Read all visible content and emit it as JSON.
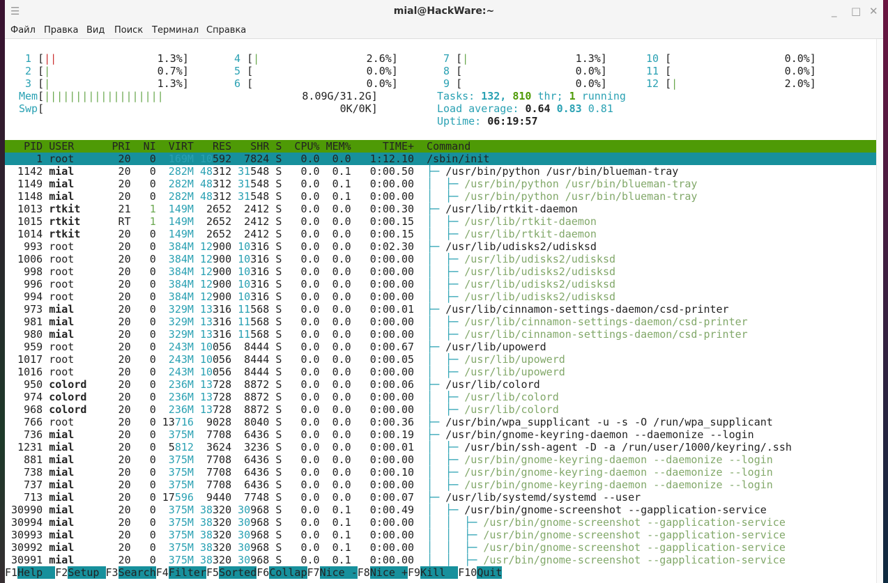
{
  "window": {
    "title": "mial@HackWare:~",
    "menu_icon": "hamburger-icon",
    "minimize_icon": "minimize-icon",
    "maximize_icon": "maximize-icon",
    "close_icon": "close-icon"
  },
  "menu": [
    "Файл",
    "Правка",
    "Вид",
    "Поиск",
    "Терминал",
    "Справка"
  ],
  "meters": {
    "cpus": [
      {
        "n": "1",
        "bar": "||",
        "pct": "1.3%]"
      },
      {
        "n": "2",
        "bar": "|",
        "pct": "0.7%]"
      },
      {
        "n": "3",
        "bar": "|",
        "pct": "1.3%]"
      },
      {
        "n": "4",
        "bar": "|",
        "pct": "2.6%]"
      },
      {
        "n": "5",
        "bar": "",
        "pct": "0.0%]"
      },
      {
        "n": "6",
        "bar": "",
        "pct": "0.0%]"
      },
      {
        "n": "7",
        "bar": "|",
        "pct": "1.3%]"
      },
      {
        "n": "8",
        "bar": "",
        "pct": "0.0%]"
      },
      {
        "n": "9",
        "bar": "",
        "pct": "0.0%]"
      },
      {
        "n": "10",
        "bar": "",
        "pct": "0.0%]"
      },
      {
        "n": "11",
        "bar": "",
        "pct": "0.0%]"
      },
      {
        "n": "12",
        "bar": "|",
        "pct": "2.0%]"
      }
    ],
    "mem": {
      "label": "Mem",
      "bar": "|||||||||||||||||||",
      "value": "8.09G/31.2G]"
    },
    "swp": {
      "label": "Swp",
      "value": "0K/0K]"
    },
    "tasks": {
      "label": "Tasks:",
      "count": "132,",
      "thr": "810",
      "thr_label": "thr;",
      "running": "1",
      "running_label": "running"
    },
    "load": {
      "label": "Load average:",
      "v1": "0.64",
      "v2": "0.83",
      "v3": "0.81"
    },
    "uptime": {
      "label": "Uptime:",
      "value": "06:19:57"
    }
  },
  "columns": [
    "PID",
    "USER",
    "PRI",
    "NI",
    "VIRT",
    "RES",
    "SHR",
    "S",
    "CPU%",
    "MEM%",
    "TIME+",
    "Command"
  ],
  "processes": [
    {
      "pid": "1",
      "user": "root",
      "pri": "20",
      "ni": "0",
      "virt": "169M",
      "res": "10592",
      "shr": "7824",
      "s": "S",
      "cpu": "0.0",
      "mem": "0.0",
      "time": "1:12.10",
      "cmd": "/sbin/init",
      "depth": 0,
      "selected": true
    },
    {
      "pid": "1142",
      "user": "mial",
      "pri": "20",
      "ni": "0",
      "virt": "282M",
      "res": "48312",
      "shr": "31548",
      "s": "S",
      "cpu": "0.0",
      "mem": "0.1",
      "time": "0:00.50",
      "cmd": "/usr/bin/python /usr/bin/blueman-tray",
      "depth": 1
    },
    {
      "pid": "1149",
      "user": "mial",
      "pri": "20",
      "ni": "0",
      "virt": "282M",
      "res": "48312",
      "shr": "31548",
      "s": "S",
      "cpu": "0.0",
      "mem": "0.1",
      "time": "0:00.00",
      "cmd": "/usr/bin/python /usr/bin/blueman-tray",
      "depth": 2
    },
    {
      "pid": "1148",
      "user": "mial",
      "pri": "20",
      "ni": "0",
      "virt": "282M",
      "res": "48312",
      "shr": "31548",
      "s": "S",
      "cpu": "0.0",
      "mem": "0.1",
      "time": "0:00.00",
      "cmd": "/usr/bin/python /usr/bin/blueman-tray",
      "depth": 2
    },
    {
      "pid": "1013",
      "user": "rtkit",
      "pri": "21",
      "ni": "1",
      "virt": "149M",
      "res": "2652",
      "shr": "2412",
      "s": "S",
      "cpu": "0.0",
      "mem": "0.0",
      "time": "0:00.30",
      "cmd": "/usr/lib/rtkit-daemon",
      "depth": 1
    },
    {
      "pid": "1015",
      "user": "rtkit",
      "pri": "RT",
      "ni": "1",
      "virt": "149M",
      "res": "2652",
      "shr": "2412",
      "s": "S",
      "cpu": "0.0",
      "mem": "0.0",
      "time": "0:00.15",
      "cmd": "/usr/lib/rtkit-daemon",
      "depth": 2
    },
    {
      "pid": "1014",
      "user": "rtkit",
      "pri": "20",
      "ni": "0",
      "virt": "149M",
      "res": "2652",
      "shr": "2412",
      "s": "S",
      "cpu": "0.0",
      "mem": "0.0",
      "time": "0:00.15",
      "cmd": "/usr/lib/rtkit-daemon",
      "depth": 2
    },
    {
      "pid": "993",
      "user": "root",
      "pri": "20",
      "ni": "0",
      "virt": "384M",
      "res": "12900",
      "shr": "10316",
      "s": "S",
      "cpu": "0.0",
      "mem": "0.0",
      "time": "0:02.30",
      "cmd": "/usr/lib/udisks2/udisksd",
      "depth": 1
    },
    {
      "pid": "1006",
      "user": "root",
      "pri": "20",
      "ni": "0",
      "virt": "384M",
      "res": "12900",
      "shr": "10316",
      "s": "S",
      "cpu": "0.0",
      "mem": "0.0",
      "time": "0:00.00",
      "cmd": "/usr/lib/udisks2/udisksd",
      "depth": 2
    },
    {
      "pid": "998",
      "user": "root",
      "pri": "20",
      "ni": "0",
      "virt": "384M",
      "res": "12900",
      "shr": "10316",
      "s": "S",
      "cpu": "0.0",
      "mem": "0.0",
      "time": "0:00.00",
      "cmd": "/usr/lib/udisks2/udisksd",
      "depth": 2
    },
    {
      "pid": "996",
      "user": "root",
      "pri": "20",
      "ni": "0",
      "virt": "384M",
      "res": "12900",
      "shr": "10316",
      "s": "S",
      "cpu": "0.0",
      "mem": "0.0",
      "time": "0:00.00",
      "cmd": "/usr/lib/udisks2/udisksd",
      "depth": 2
    },
    {
      "pid": "994",
      "user": "root",
      "pri": "20",
      "ni": "0",
      "virt": "384M",
      "res": "12900",
      "shr": "10316",
      "s": "S",
      "cpu": "0.0",
      "mem": "0.0",
      "time": "0:00.00",
      "cmd": "/usr/lib/udisks2/udisksd",
      "depth": 2
    },
    {
      "pid": "973",
      "user": "mial",
      "pri": "20",
      "ni": "0",
      "virt": "329M",
      "res": "13316",
      "shr": "11568",
      "s": "S",
      "cpu": "0.0",
      "mem": "0.0",
      "time": "0:00.01",
      "cmd": "/usr/lib/cinnamon-settings-daemon/csd-printer",
      "depth": 1
    },
    {
      "pid": "981",
      "user": "mial",
      "pri": "20",
      "ni": "0",
      "virt": "329M",
      "res": "13316",
      "shr": "11568",
      "s": "S",
      "cpu": "0.0",
      "mem": "0.0",
      "time": "0:00.00",
      "cmd": "/usr/lib/cinnamon-settings-daemon/csd-printer",
      "depth": 2
    },
    {
      "pid": "980",
      "user": "mial",
      "pri": "20",
      "ni": "0",
      "virt": "329M",
      "res": "13316",
      "shr": "11568",
      "s": "S",
      "cpu": "0.0",
      "mem": "0.0",
      "time": "0:00.00",
      "cmd": "/usr/lib/cinnamon-settings-daemon/csd-printer",
      "depth": 2
    },
    {
      "pid": "959",
      "user": "root",
      "pri": "20",
      "ni": "0",
      "virt": "243M",
      "res": "10056",
      "shr": "8444",
      "s": "S",
      "cpu": "0.0",
      "mem": "0.0",
      "time": "0:00.67",
      "cmd": "/usr/lib/upowerd",
      "depth": 1
    },
    {
      "pid": "1017",
      "user": "root",
      "pri": "20",
      "ni": "0",
      "virt": "243M",
      "res": "10056",
      "shr": "8444",
      "s": "S",
      "cpu": "0.0",
      "mem": "0.0",
      "time": "0:00.05",
      "cmd": "/usr/lib/upowerd",
      "depth": 2
    },
    {
      "pid": "1016",
      "user": "root",
      "pri": "20",
      "ni": "0",
      "virt": "243M",
      "res": "10056",
      "shr": "8444",
      "s": "S",
      "cpu": "0.0",
      "mem": "0.0",
      "time": "0:00.00",
      "cmd": "/usr/lib/upowerd",
      "depth": 2
    },
    {
      "pid": "950",
      "user": "colord",
      "pri": "20",
      "ni": "0",
      "virt": "236M",
      "res": "13728",
      "shr": "8872",
      "s": "S",
      "cpu": "0.0",
      "mem": "0.0",
      "time": "0:00.06",
      "cmd": "/usr/lib/colord",
      "depth": 1
    },
    {
      "pid": "974",
      "user": "colord",
      "pri": "20",
      "ni": "0",
      "virt": "236M",
      "res": "13728",
      "shr": "8872",
      "s": "S",
      "cpu": "0.0",
      "mem": "0.0",
      "time": "0:00.00",
      "cmd": "/usr/lib/colord",
      "depth": 2
    },
    {
      "pid": "968",
      "user": "colord",
      "pri": "20",
      "ni": "0",
      "virt": "236M",
      "res": "13728",
      "shr": "8872",
      "s": "S",
      "cpu": "0.0",
      "mem": "0.0",
      "time": "0:00.00",
      "cmd": "/usr/lib/colord",
      "depth": 2
    },
    {
      "pid": "766",
      "user": "root",
      "pri": "20",
      "ni": "0",
      "virt": "13716",
      "res": "9028",
      "shr": "8040",
      "s": "S",
      "cpu": "0.0",
      "mem": "0.0",
      "time": "0:00.36",
      "cmd": "/usr/bin/wpa_supplicant -u -s -O /run/wpa_supplicant",
      "depth": 1
    },
    {
      "pid": "736",
      "user": "mial",
      "pri": "20",
      "ni": "0",
      "virt": "375M",
      "res": "7708",
      "shr": "6436",
      "s": "S",
      "cpu": "0.0",
      "mem": "0.0",
      "time": "0:00.19",
      "cmd": "/usr/bin/gnome-keyring-daemon --daemonize --login",
      "depth": 1
    },
    {
      "pid": "1231",
      "user": "mial",
      "pri": "20",
      "ni": "0",
      "virt": "5812",
      "res": "3624",
      "shr": "3236",
      "s": "S",
      "cpu": "0.0",
      "mem": "0.0",
      "time": "0:00.01",
      "cmd": "/usr/bin/ssh-agent -D -a /run/user/1000/keyring/.ssh",
      "depth": 2,
      "normal": true
    },
    {
      "pid": "881",
      "user": "mial",
      "pri": "20",
      "ni": "0",
      "virt": "375M",
      "res": "7708",
      "shr": "6436",
      "s": "S",
      "cpu": "0.0",
      "mem": "0.0",
      "time": "0:00.00",
      "cmd": "/usr/bin/gnome-keyring-daemon --daemonize --login",
      "depth": 2
    },
    {
      "pid": "738",
      "user": "mial",
      "pri": "20",
      "ni": "0",
      "virt": "375M",
      "res": "7708",
      "shr": "6436",
      "s": "S",
      "cpu": "0.0",
      "mem": "0.0",
      "time": "0:00.10",
      "cmd": "/usr/bin/gnome-keyring-daemon --daemonize --login",
      "depth": 2
    },
    {
      "pid": "737",
      "user": "mial",
      "pri": "20",
      "ni": "0",
      "virt": "375M",
      "res": "7708",
      "shr": "6436",
      "s": "S",
      "cpu": "0.0",
      "mem": "0.0",
      "time": "0:00.00",
      "cmd": "/usr/bin/gnome-keyring-daemon --daemonize --login",
      "depth": 2
    },
    {
      "pid": "713",
      "user": "mial",
      "pri": "20",
      "ni": "0",
      "virt": "17596",
      "res": "9440",
      "shr": "7748",
      "s": "S",
      "cpu": "0.0",
      "mem": "0.0",
      "time": "0:00.07",
      "cmd": "/usr/lib/systemd/systemd --user",
      "depth": 1
    },
    {
      "pid": "30990",
      "user": "mial",
      "pri": "20",
      "ni": "0",
      "virt": "375M",
      "res": "38320",
      "shr": "30968",
      "s": "S",
      "cpu": "0.0",
      "mem": "0.1",
      "time": "0:00.49",
      "cmd": "/usr/bin/gnome-screenshot --gapplication-service",
      "depth": 2,
      "normal": true
    },
    {
      "pid": "30994",
      "user": "mial",
      "pri": "20",
      "ni": "0",
      "virt": "375M",
      "res": "38320",
      "shr": "30968",
      "s": "S",
      "cpu": "0.0",
      "mem": "0.1",
      "time": "0:00.00",
      "cmd": "/usr/bin/gnome-screenshot --gapplication-service",
      "depth": 3
    },
    {
      "pid": "30993",
      "user": "mial",
      "pri": "20",
      "ni": "0",
      "virt": "375M",
      "res": "38320",
      "shr": "30968",
      "s": "S",
      "cpu": "0.0",
      "mem": "0.1",
      "time": "0:00.00",
      "cmd": "/usr/bin/gnome-screenshot --gapplication-service",
      "depth": 3
    },
    {
      "pid": "30992",
      "user": "mial",
      "pri": "20",
      "ni": "0",
      "virt": "375M",
      "res": "38320",
      "shr": "30968",
      "s": "S",
      "cpu": "0.0",
      "mem": "0.1",
      "time": "0:00.00",
      "cmd": "/usr/bin/gnome-screenshot --gapplication-service",
      "depth": 3
    },
    {
      "pid": "30991",
      "user": "mial",
      "pri": "20",
      "ni": "0",
      "virt": "375M",
      "res": "38320",
      "shr": "30968",
      "s": "S",
      "cpu": "0.0",
      "mem": "0.1",
      "time": "0:00.00",
      "cmd": "/usr/bin/gnome-screenshot --gapplication-service",
      "depth": 3
    }
  ],
  "fkeys": [
    {
      "key": "F1",
      "label": "Help  "
    },
    {
      "key": "F2",
      "label": "Setup "
    },
    {
      "key": "F3",
      "label": "Search"
    },
    {
      "key": "F4",
      "label": "Filter"
    },
    {
      "key": "F5",
      "label": "Sorted"
    },
    {
      "key": "F6",
      "label": "Collap"
    },
    {
      "key": "F7",
      "label": "Nice -"
    },
    {
      "key": "F8",
      "label": "Nice +"
    },
    {
      "key": "F9",
      "label": "Kill  "
    },
    {
      "key": "F10",
      "label": "Quit"
    }
  ],
  "colors": {
    "accent": "#17909c",
    "header": "#4e9a06",
    "cyan": "#2aa1b3",
    "thread_green": "#82a86a"
  }
}
